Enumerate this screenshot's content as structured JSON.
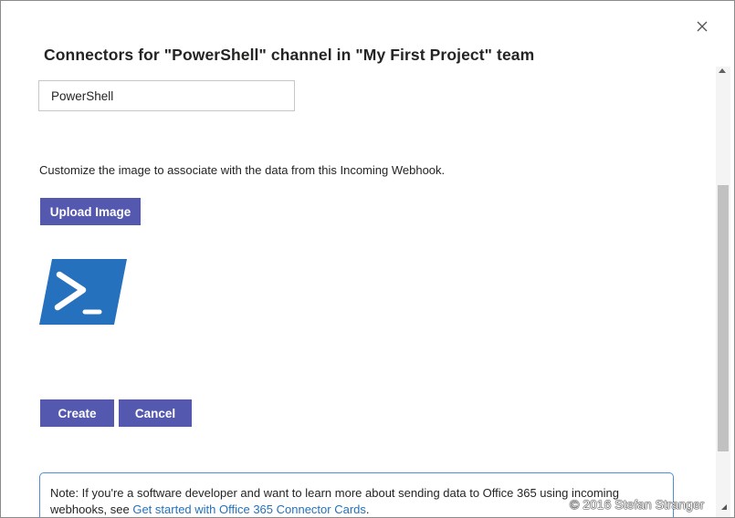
{
  "dialog": {
    "title": "Connectors for \"PowerShell\" channel in \"My First Project\" team",
    "name_value": "PowerShell",
    "description": "Customize the image to associate with the data from this Incoming Webhook.",
    "upload_label": "Upload Image",
    "create_label": "Create",
    "cancel_label": "Cancel",
    "note_text": "Note: If you're a software developer and want to learn more about sending data to Office 365 using incoming webhooks, see ",
    "note_link": "Get started with Office 365 Connector Cards",
    "note_end": "."
  },
  "icons": {
    "close": "close-icon",
    "logo": "powershell-logo"
  },
  "watermark": "© 2016 Stefan Stranger",
  "colors": {
    "accent": "#5558af",
    "logo": "#2671be",
    "link": "#2471ba",
    "note_border": "#4c8fd6"
  }
}
